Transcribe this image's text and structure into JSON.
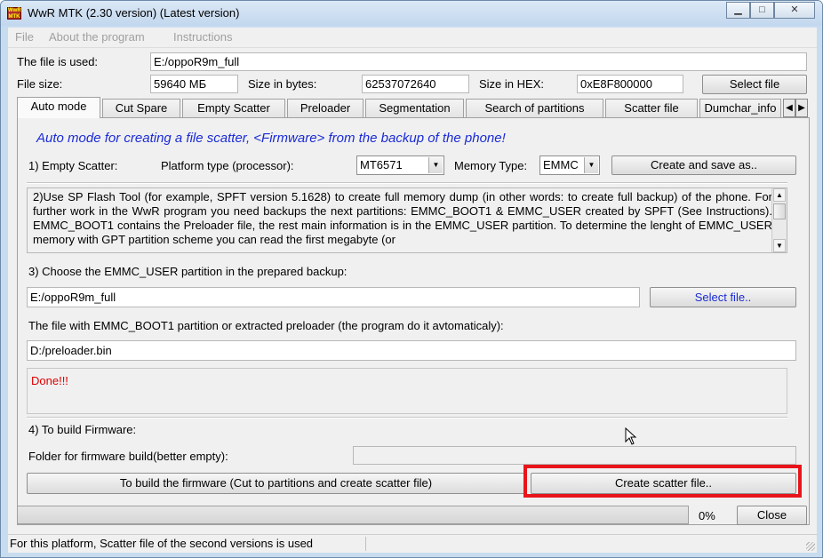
{
  "window": {
    "title": "WwR MTK (2.30 version) (Latest version)",
    "icon_label": "WwR MTK",
    "controls": {
      "minimize": "▁",
      "maximize": "□",
      "close": "✕"
    }
  },
  "menu": [
    "File",
    "About the program",
    "Instructions"
  ],
  "file_info": {
    "used_label": "The file is used:",
    "used_value": "E:/oppoR9m_full",
    "size_label": "File size:",
    "size_value": "59640 МБ",
    "bytes_label": "Size in bytes:",
    "bytes_value": "62537072640",
    "hex_label": "Size in HEX:",
    "hex_value": "0xE8F800000",
    "select_button": "Select file"
  },
  "tabs": [
    "Auto mode",
    "Cut Spare",
    "Empty Scatter",
    "Preloader",
    "Segmentation",
    "Search of partitions",
    "Scatter file",
    "Dumchar_info"
  ],
  "tab_arrows": {
    "left": "◀",
    "right": "▶"
  },
  "auto": {
    "heading": "Auto mode for creating a file scatter, <Firmware> from the backup of the phone!",
    "step1_label": "1) Empty Scatter:",
    "platform_label": "Platform type (processor):",
    "platform_value": "MT6571",
    "memory_label": "Memory Type:",
    "memory_value": "EMMC",
    "dropdown_arrow": "▼",
    "create_save_button": "Create and save as..",
    "memo_text": "2)Use SP Flash Tool (for example, SPFT version 5.1628) to create full memory dump (in other words: to create full backup) of the phone. For further work in the WwR program you need backups the next partitions: EMMC_BOOT1 & EMMC_USER created by SPFT (See Instructions). EMMC_BOOT1 contains the Preloader file, the rest main information is in the EMMC_USER partition. To determine the lenght of EMMC_USER memory with GPT partition scheme you can read the first megabyte (or",
    "scroll_up": "▲",
    "scroll_down": "▼",
    "step3_label": "3) Choose the EMMC_USER partition in the prepared backup:",
    "user_path": "E:/oppoR9m_full",
    "select_file_button": "Select file..",
    "boot_label": "The file with EMMC_BOOT1 partition or extracted preloader (the program do it avtomaticaly):",
    "boot_path": "D:/preloader.bin",
    "log_text": "Done!!!",
    "step4_label": "4) To build Firmware:",
    "folder_label": "Folder for firmware build(better empty):",
    "folder_value": "",
    "build_button": "To build the firmware (Cut to partitions and create scatter file)",
    "create_scatter_button": "Create scatter file.."
  },
  "progress": {
    "value": 0,
    "label": "0%"
  },
  "close_button": "Close",
  "status": "For this platform, Scatter file of the second versions is used",
  "colors": {
    "heading": "#1a2bd6",
    "log": "#dd0000",
    "highlight": "#e8141a"
  }
}
